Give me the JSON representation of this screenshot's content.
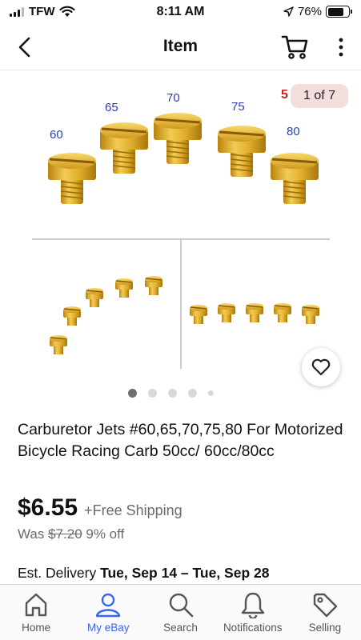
{
  "status_bar": {
    "carrier": "TFW",
    "time": "8:11 AM",
    "battery": "76%",
    "battery_level": 0.76
  },
  "nav": {
    "title": "Item",
    "icons": [
      "back-chevron-icon",
      "cart-icon",
      "more-vertical-icon"
    ]
  },
  "gallery": {
    "counter": "1 of 7",
    "jet_labels": [
      "60",
      "65",
      "70",
      "75",
      "80"
    ],
    "partial_label": "5",
    "dots_count": 5,
    "active_dot": 0,
    "favorite_icon": "heart-icon"
  },
  "item": {
    "title": "Carburetor Jets #60,65,70,75,80 For Motorized Bicycle Racing Carb 50cc/ 60cc/80cc",
    "price": "$6.55",
    "shipping": "+Free Shipping",
    "was_label": "Was",
    "was_price": "$7.20",
    "discount": "9% off",
    "delivery_label": "Est. Delivery",
    "delivery_dates": "Tue, Sep 14 – Tue, Sep 28"
  },
  "tabs": [
    {
      "label": "Home",
      "icon": "home-icon"
    },
    {
      "label": "My eBay",
      "icon": "person-icon"
    },
    {
      "label": "Search",
      "icon": "search-icon"
    },
    {
      "label": "Notifications",
      "icon": "bell-icon"
    },
    {
      "label": "Selling",
      "icon": "tag-icon"
    }
  ],
  "colors": {
    "accent": "#3665f3",
    "brass": "#d9a521",
    "counter_bg": "#f3dede",
    "label_blue": "#2a3fb0"
  }
}
